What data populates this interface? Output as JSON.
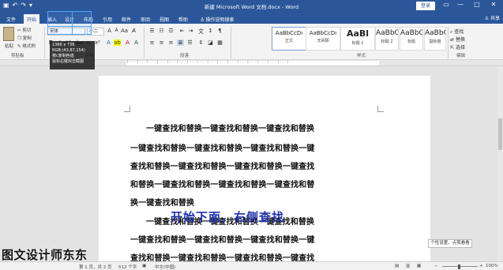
{
  "window": {
    "title": "新建 Microsoft Word 文档.docx - Word",
    "login_label": "登录",
    "minimize": "—",
    "restore": "□",
    "close": "✕"
  },
  "tabs": [
    "文件",
    "开始",
    "插入",
    "设计",
    "布局",
    "引用",
    "邮件",
    "审阅",
    "视图",
    "帮助"
  ],
  "tell_me": "操作说明搜索",
  "share_label": "共享",
  "ribbon": {
    "paste_label": "粘贴",
    "cut_label": "剪切",
    "copy_label": "复制",
    "format_painter_label": "格式刷",
    "font_name": "宋体",
    "font_size": "小二",
    "groups": {
      "clipboard": "剪贴板",
      "font": "字体",
      "paragraph": "段落",
      "styles": "样式",
      "editing": "编辑"
    },
    "styles": [
      {
        "sample": "AaBbCcDı",
        "name": "正文"
      },
      {
        "sample": "AaBbCcDı",
        "name": "无间隔"
      },
      {
        "sample": "AaBl",
        "name": "标题 1"
      },
      {
        "sample": "AaBbC",
        "name": "标题 2"
      },
      {
        "sample": "AaBbC",
        "name": "标题"
      },
      {
        "sample": "AaBbC",
        "name": "副标题"
      }
    ],
    "editing": {
      "find": "查找",
      "replace": "替换",
      "select": "选择"
    }
  },
  "screen_picker": {
    "size": "1366 x 738",
    "rgb": "RGB:(43,87,154)",
    "hint1": "按c复制色值",
    "hint2": "鼠标右键双击截图"
  },
  "document": {
    "lines": [
      "一键查找和替换一键查找和替换一键查找和替换",
      "一键查找和替换一键查找和替换一键查找和替换一键",
      "查找和替换一键查找和替换一键查找和替换一键查找",
      "和替换一键查找和替换一键查找和替换一键查找和替",
      "换一键查找和替换",
      "一键查找和替换一键查找和替换一键查找和替换",
      "一键查找和替换一键查找和替换一键查找和替换一键",
      "查找和替换一键查找和替换一键查找和替换一键查找"
    ]
  },
  "overlay_caption": "开始下面，右侧查找",
  "tooltip": "个性设置，点我看看",
  "watermark": "图文设计师东东",
  "status": {
    "page": "第 1 页，共 2 页",
    "words": "512 个字",
    "language": "中文(中国)",
    "zoom": "100%"
  }
}
